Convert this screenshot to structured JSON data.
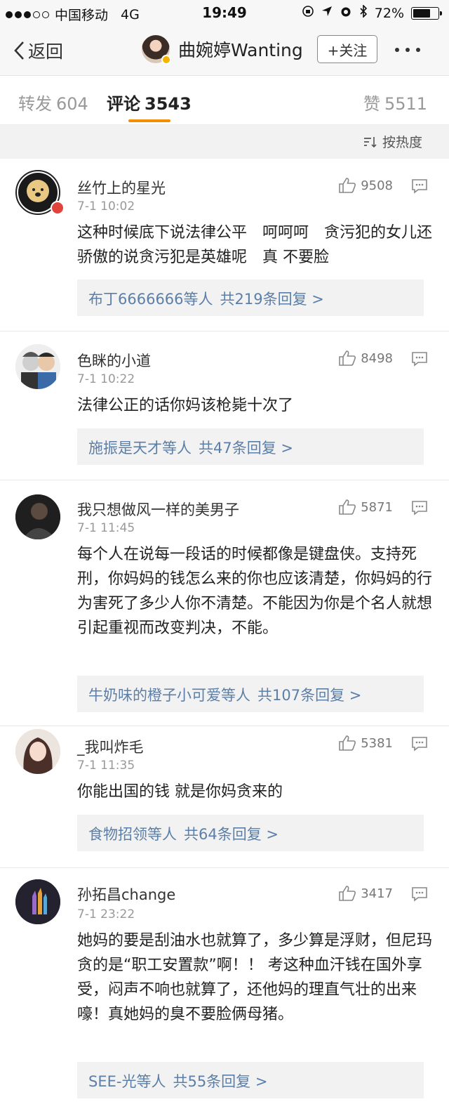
{
  "status_bar": {
    "carrier": "中国移动",
    "network": "4G",
    "time": "19:49",
    "battery_text": "72%",
    "battery_level": 0.72
  },
  "nav": {
    "back_label": "返回",
    "user_name": "曲婉婷Wanting",
    "follow_label": "+关注"
  },
  "tabs": [
    {
      "label": "转发",
      "count": "604"
    },
    {
      "label": "评论",
      "count": "3543"
    },
    {
      "label": "赞",
      "count": "5511"
    }
  ],
  "sort_label": "按热度",
  "colors": {
    "accent": "#f28e00",
    "link": "#5b7fa8"
  },
  "comments": [
    {
      "name": "丝竹上的星光",
      "time": "7-1 10:02",
      "likes": "9508",
      "text": "这种时候底下说法律公平　呵呵呵　贪污犯的女儿还骄傲的说贪污犯是英雄呢　真 不要脸",
      "reply_users": "布丁6666666等人",
      "reply_count": "共219条回复 >"
    },
    {
      "name": "色眯的小道",
      "time": "7-1 10:22",
      "likes": "8498",
      "text": "法律公正的话你妈该枪毙十次了",
      "reply_users": "施振是天才等人",
      "reply_count": "共47条回复 >"
    },
    {
      "name": "我只想做风一样的美男子",
      "time": "7-1 11:45",
      "likes": "5871",
      "text": "每个人在说每一段话的时候都像是键盘侠。支持死刑，你妈妈的钱怎么来的你也应该清楚，你妈妈的行为害死了多少人你不清楚。不能因为你是个名人就想引起重视而改变判决，不能。",
      "reply_users": "牛奶味的橙子小可爱等人",
      "reply_count": "共107条回复 >"
    },
    {
      "name": "_我叫炸毛",
      "time": "7-1 11:35",
      "likes": "5381",
      "text": "你能出国的钱 就是你妈贪来的",
      "reply_users": "食物招领等人",
      "reply_count": "共64条回复 >"
    },
    {
      "name": "孙拓昌change",
      "time": "7-1 23:22",
      "likes": "3417",
      "text": "她妈的要是刮油水也就算了，多少算是浮财，但尼玛贪的是“职工安置款”啊！！ 考这种血汗钱在国外享受，闷声不响也就算了，还他妈的理直气壮的出来嚎！真她妈的臭不要脸俩母猪。",
      "reply_users": "SEE-光等人",
      "reply_count": "共55条回复 >"
    }
  ]
}
